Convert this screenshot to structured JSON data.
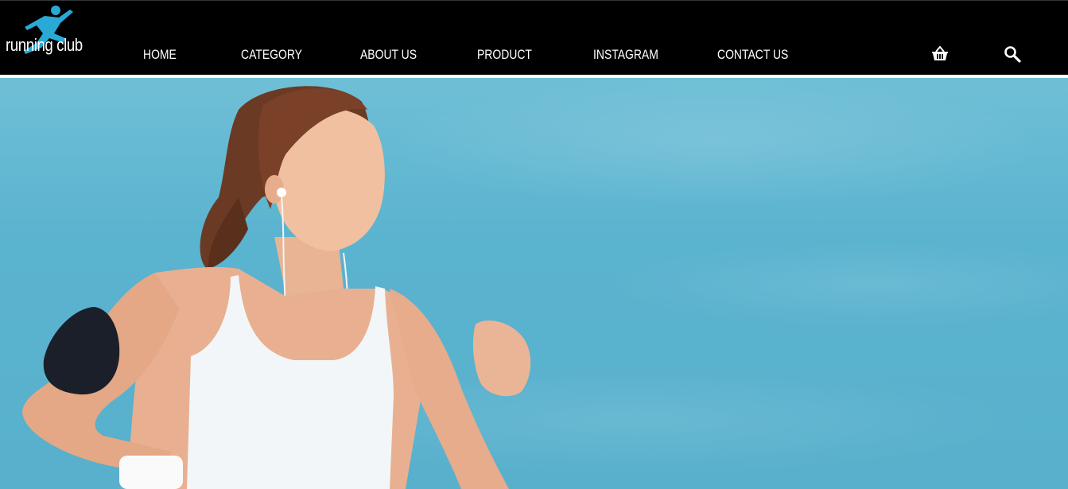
{
  "brand": {
    "logo_text": "running club",
    "accent": "#29a9d6"
  },
  "nav": {
    "items": [
      {
        "label": "HOME"
      },
      {
        "label": "CATEGORY"
      },
      {
        "label": "ABOUT US"
      },
      {
        "label": "PRODUCT"
      },
      {
        "label": "INSTAGRAM"
      },
      {
        "label": "CONTACT US"
      }
    ]
  },
  "icons": {
    "cart": "basket-icon",
    "search": "search-icon",
    "logo": "runner-icon"
  },
  "hero": {
    "image": "woman-jogging-photo"
  },
  "colors": {
    "header_bg": "#000000",
    "divider": "#ffffff",
    "hero_sky": "#5ab3cf"
  }
}
